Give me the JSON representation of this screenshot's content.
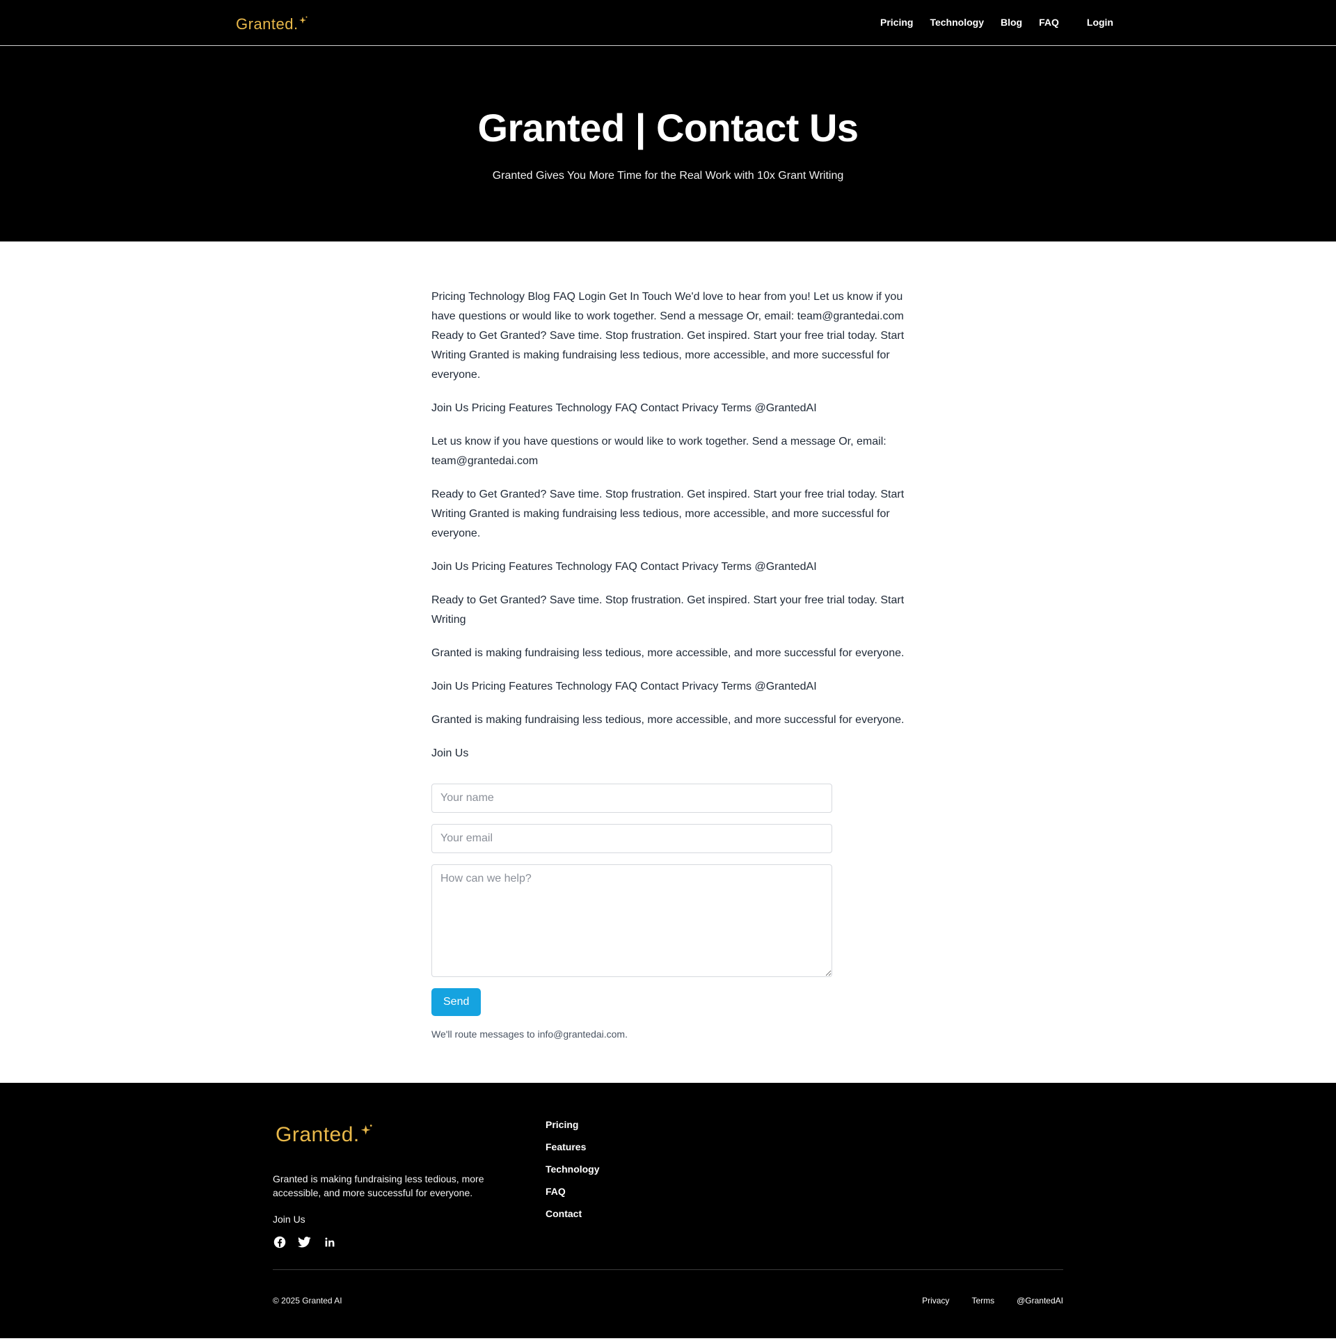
{
  "nav": {
    "logo_text": "Granted",
    "logo_dot": ".",
    "links": [
      "Pricing",
      "Technology",
      "Blog",
      "FAQ"
    ],
    "login": "Login"
  },
  "hero": {
    "title": "Granted | Contact Us",
    "subtitle": "Granted Gives You More Time for the Real Work with 10x Grant Writing"
  },
  "main": {
    "paragraphs": [
      "Pricing Technology Blog FAQ Login Get In Touch We'd love to hear from you! Let us know if you have questions or would like to work together. Send a message Or, email: team@grantedai.com Ready to Get Granted? Save time. Stop frustration. Get inspired. Start your free trial today. Start Writing Granted is making fundraising less tedious, more accessible, and more successful for everyone.",
      "Join Us Pricing Features Technology FAQ Contact Privacy Terms @GrantedAI",
      "Let us know if you have questions or would like to work together. Send a message Or, email: team@grantedai.com",
      "Ready to Get Granted? Save time. Stop frustration. Get inspired. Start your free trial today. Start Writing Granted is making fundraising less tedious, more accessible, and more successful for everyone.",
      "Join Us Pricing Features Technology FAQ Contact Privacy Terms @GrantedAI",
      "Ready to Get Granted? Save time. Stop frustration. Get inspired. Start your free trial today. Start Writing",
      "Granted is making fundraising less tedious, more accessible, and more successful for everyone.",
      "Join Us Pricing Features Technology FAQ Contact Privacy Terms @GrantedAI",
      "Granted is making fundraising less tedious, more accessible, and more successful for everyone.",
      "Join Us"
    ]
  },
  "form": {
    "name_placeholder": "Your name",
    "email_placeholder": "Your email",
    "message_placeholder": "How can we help?",
    "send_label": "Send",
    "route_note": "We'll route messages to info@grantedai.com."
  },
  "footer": {
    "logo_text": "Granted",
    "logo_dot": ".",
    "description": "Granted is making fundraising less tedious, more accessible, and more successful for everyone.",
    "join_label": "Join Us",
    "social_icons": [
      "facebook-icon",
      "twitter-icon",
      "linkedin-icon"
    ],
    "links": [
      "Pricing",
      "Features",
      "Technology",
      "FAQ",
      "Contact"
    ],
    "copyright": "© 2025 Granted AI",
    "bottom_links": [
      "Privacy",
      "Terms",
      "@GrantedAI"
    ]
  },
  "colors": {
    "brand_gold": "#e8b84a",
    "send_button": "#15a3e0",
    "dark_bg": "#000000"
  }
}
